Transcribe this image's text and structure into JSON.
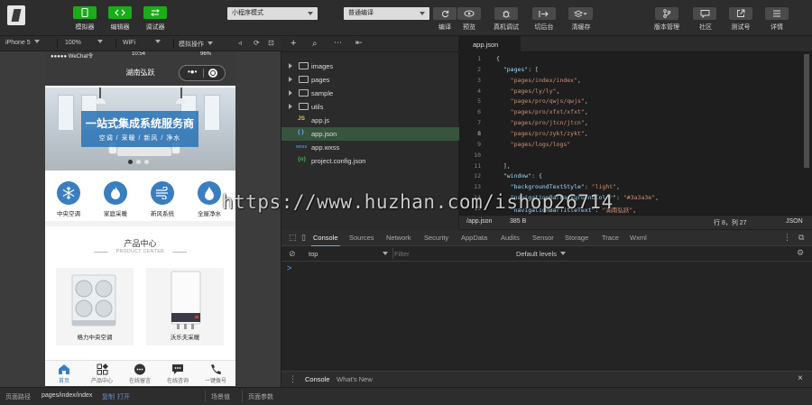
{
  "toolbar": {
    "simulator_label": "模拟器",
    "editor_label": "编辑器",
    "debugger_label": "调试器",
    "mode_select": "小程序模式",
    "compile_select": "普通编译",
    "compile_label": "编译",
    "preview_label": "预览",
    "remote_debug_label": "真机调试",
    "backend_label": "切后台",
    "cache_label": "清缓存",
    "version_label": "版本管理",
    "community_label": "社区",
    "test_label": "测试号",
    "details_label": "详情",
    "accent": "#1aad19"
  },
  "device_bar": {
    "device": "iPhone 5",
    "zoom": "100%",
    "network": "WiFi",
    "simulate": "模拟操作"
  },
  "phone": {
    "status_carrier": "●●●●● WeChat令",
    "status_time": "10:54",
    "status_battery": "96%",
    "nav_title": "湖南弘跃",
    "capsule_dots": "•●•",
    "banner_title": "一站式集成系统服务商",
    "banner_subtitle": "空调 / 采暖 / 新风 / 净水",
    "categories": [
      {
        "label": "中央空调",
        "icon": "snowflake-icon"
      },
      {
        "label": "家庭采暖",
        "icon": "flame-icon"
      },
      {
        "label": "新风系统",
        "icon": "wind-icon"
      },
      {
        "label": "全屋净水",
        "icon": "water-drop-icon"
      }
    ],
    "section_title": "产品中心",
    "section_subtitle": "PRODUCT CENTER",
    "products": [
      {
        "label": "格力中央空调"
      },
      {
        "label": "沃乐夫采暖"
      }
    ],
    "tabs": [
      {
        "label": "首页",
        "icon": "home-icon",
        "active": true
      },
      {
        "label": "产品中心",
        "icon": "grid-icon",
        "active": false
      },
      {
        "label": "在线留言",
        "icon": "chat-bubble-icon",
        "active": false
      },
      {
        "label": "在线咨询",
        "icon": "message-icon",
        "active": false
      },
      {
        "label": "一键拨号",
        "icon": "phone-icon",
        "active": false
      }
    ],
    "brand_color": "#3a7ec0"
  },
  "file_tree": {
    "items": [
      {
        "name": "images",
        "type": "folder"
      },
      {
        "name": "pages",
        "type": "folder"
      },
      {
        "name": "sample",
        "type": "folder"
      },
      {
        "name": "utils",
        "type": "folder"
      },
      {
        "name": "app.js",
        "type": "js",
        "badge": "JS"
      },
      {
        "name": "app.json",
        "type": "json",
        "badge": "{ }",
        "selected": true
      },
      {
        "name": "app.wxss",
        "type": "wxss",
        "badge": "wxss"
      },
      {
        "name": "project.config.json",
        "type": "json",
        "badge": "{o}"
      }
    ]
  },
  "editor": {
    "tab": "app.json",
    "lines": [
      {
        "n": "1",
        "text": "{"
      },
      {
        "n": "2",
        "text": "  \"pages\": ["
      },
      {
        "n": "3",
        "text": "    \"pages/index/index\","
      },
      {
        "n": "4",
        "text": "    \"pages/ly/ly\","
      },
      {
        "n": "5",
        "text": "    \"pages/pro/qwjs/qwjs\","
      },
      {
        "n": "6",
        "text": "    \"pages/pro/xfxt/xfxt\","
      },
      {
        "n": "7",
        "text": "    \"pages/pro/jtcn/jtcn\","
      },
      {
        "n": "8",
        "text": "    \"pages/pro/zykt/zykt\","
      },
      {
        "n": "9",
        "text": "    \"pages/logs/logs\""
      },
      {
        "n": "10",
        "text": ""
      },
      {
        "n": "11",
        "text": "  ],"
      },
      {
        "n": "12",
        "text": "  \"window\": {"
      },
      {
        "n": "13",
        "text": "    \"backgroundTextStyle\": \"light\","
      },
      {
        "n": "14",
        "text": "    \"navigationBarBackgroundColor\": \"#3a3a3e\","
      },
      {
        "n": "15",
        "text": "    \"navigationBarTitleText\": \"湖南弘跃\","
      }
    ],
    "status_path": "/app.json",
    "status_size": "385 B",
    "status_pos": "行 8，列 27",
    "status_lang": "JSON"
  },
  "devtools": {
    "tabs": [
      "Console",
      "Sources",
      "Network",
      "Security",
      "AppData",
      "Audits",
      "Sensor",
      "Storage",
      "Trace",
      "Wxml"
    ],
    "active_tab": "Console",
    "context": "top",
    "filter_placeholder": "Filter",
    "levels": "Default levels",
    "prompt": ">",
    "drawer_tabs": [
      "Console",
      "What's New"
    ]
  },
  "bottom": {
    "path_label": "页面路径",
    "path_value": "pages/index/index",
    "copy": "复制",
    "open": "打开",
    "scene": "场景值",
    "params": "页面参数"
  },
  "watermark": "https://www.huzhan.com/ishop26714"
}
